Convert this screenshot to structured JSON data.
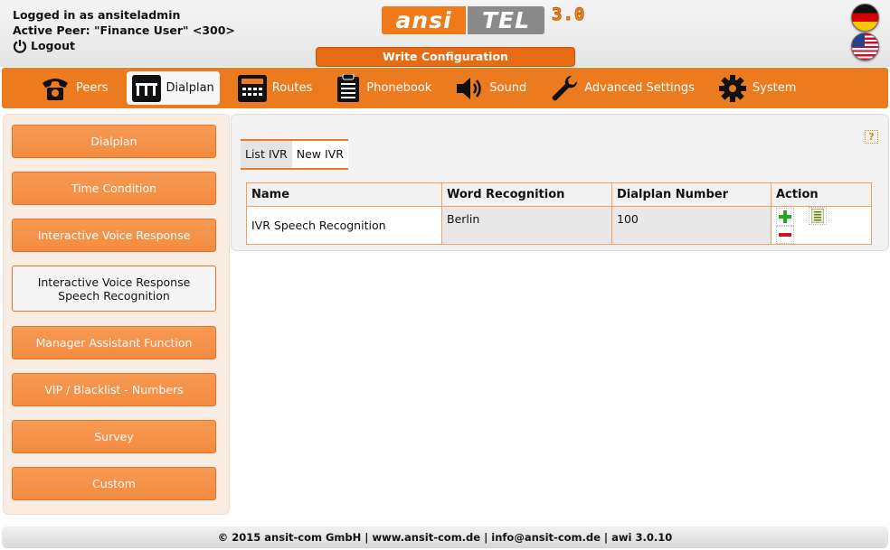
{
  "header": {
    "logged_in": "Logged in as ansiteladmin",
    "active_peer": "Active Peer: \"Finance User\" <300>",
    "logout_label": "Logout",
    "logo_ansi": "ansi",
    "logo_tel": "TEL",
    "logo_version": "3.0",
    "write_config_label": "Write Configuration",
    "flags": [
      "flag-de-icon",
      "flag-us-icon"
    ]
  },
  "nav": {
    "items": [
      {
        "label": "Peers",
        "icon": "telephone-icon"
      },
      {
        "label": "Dialplan",
        "icon": "dialplan-icon",
        "active": true
      },
      {
        "label": "Routes",
        "icon": "routes-icon"
      },
      {
        "label": "Phonebook",
        "icon": "phonebook-icon"
      },
      {
        "label": "Sound",
        "icon": "speaker-icon"
      },
      {
        "label": "Advanced Settings",
        "icon": "wrench-icon"
      },
      {
        "label": "System",
        "icon": "gear-icon"
      }
    ]
  },
  "sidebar": {
    "items": [
      {
        "label": "Dialplan"
      },
      {
        "label": "Time Condition"
      },
      {
        "label": "Interactive Voice Response"
      },
      {
        "label": "Interactive Voice Response Speech Recognition",
        "line1": "Interactive Voice Response",
        "line2": "Speech Recognition",
        "active": true
      },
      {
        "label": "Manager Assistant Function"
      },
      {
        "label": "VIP / Blacklist - Numbers"
      },
      {
        "label": "Survey"
      },
      {
        "label": "Custom"
      }
    ]
  },
  "main": {
    "help_label": "?",
    "tabs": [
      {
        "label": "List IVR"
      },
      {
        "label": "New IVR"
      }
    ],
    "table": {
      "headers": [
        "Name",
        "Word Recognition",
        "Dialplan Number",
        "Action"
      ],
      "rows": [
        {
          "name": "IVR Speech Recognition",
          "word": "Berlin",
          "number": "100"
        }
      ]
    }
  },
  "footer": {
    "text": "© 2015 ansit-com GmbH | www.ansit-com.de | info@ansit-com.de | awi 3.0.10"
  },
  "colors": {
    "accent": "#ec7a1e",
    "button": "#f38b3f",
    "sidebar_bg": "#f9ece3"
  }
}
